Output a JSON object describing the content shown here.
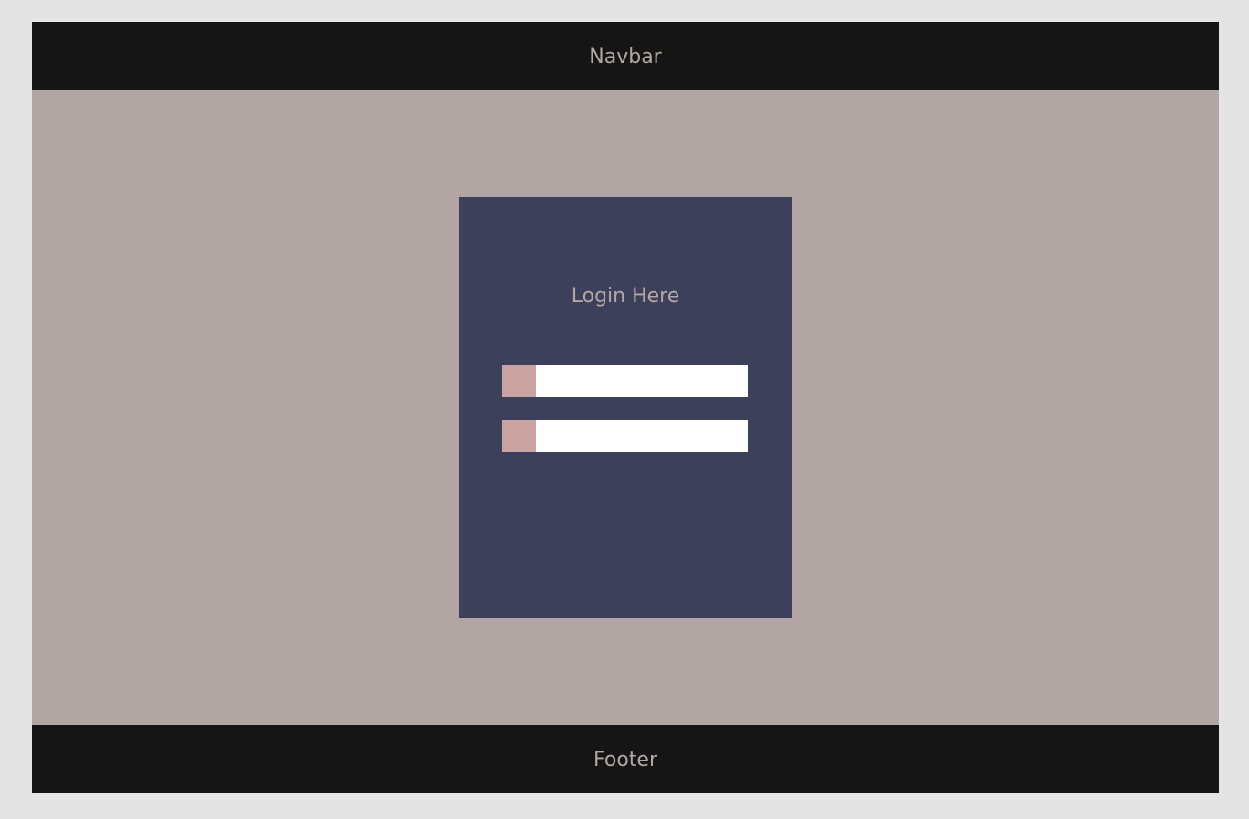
{
  "navbar": {
    "label": "Navbar"
  },
  "login": {
    "title": "Login Here",
    "fields": [
      {
        "icon": "user-icon",
        "value": "",
        "placeholder": ""
      },
      {
        "icon": "lock-icon",
        "value": "",
        "placeholder": ""
      }
    ]
  },
  "footer": {
    "label": "Footer"
  },
  "colors": {
    "page_background": "#e4e4e4",
    "bar_background": "#151515",
    "main_background": "#b2a6a4",
    "card_background": "#3c405a",
    "field_icon_background": "#c9a3a1",
    "text_color": "#b3a6a4"
  }
}
